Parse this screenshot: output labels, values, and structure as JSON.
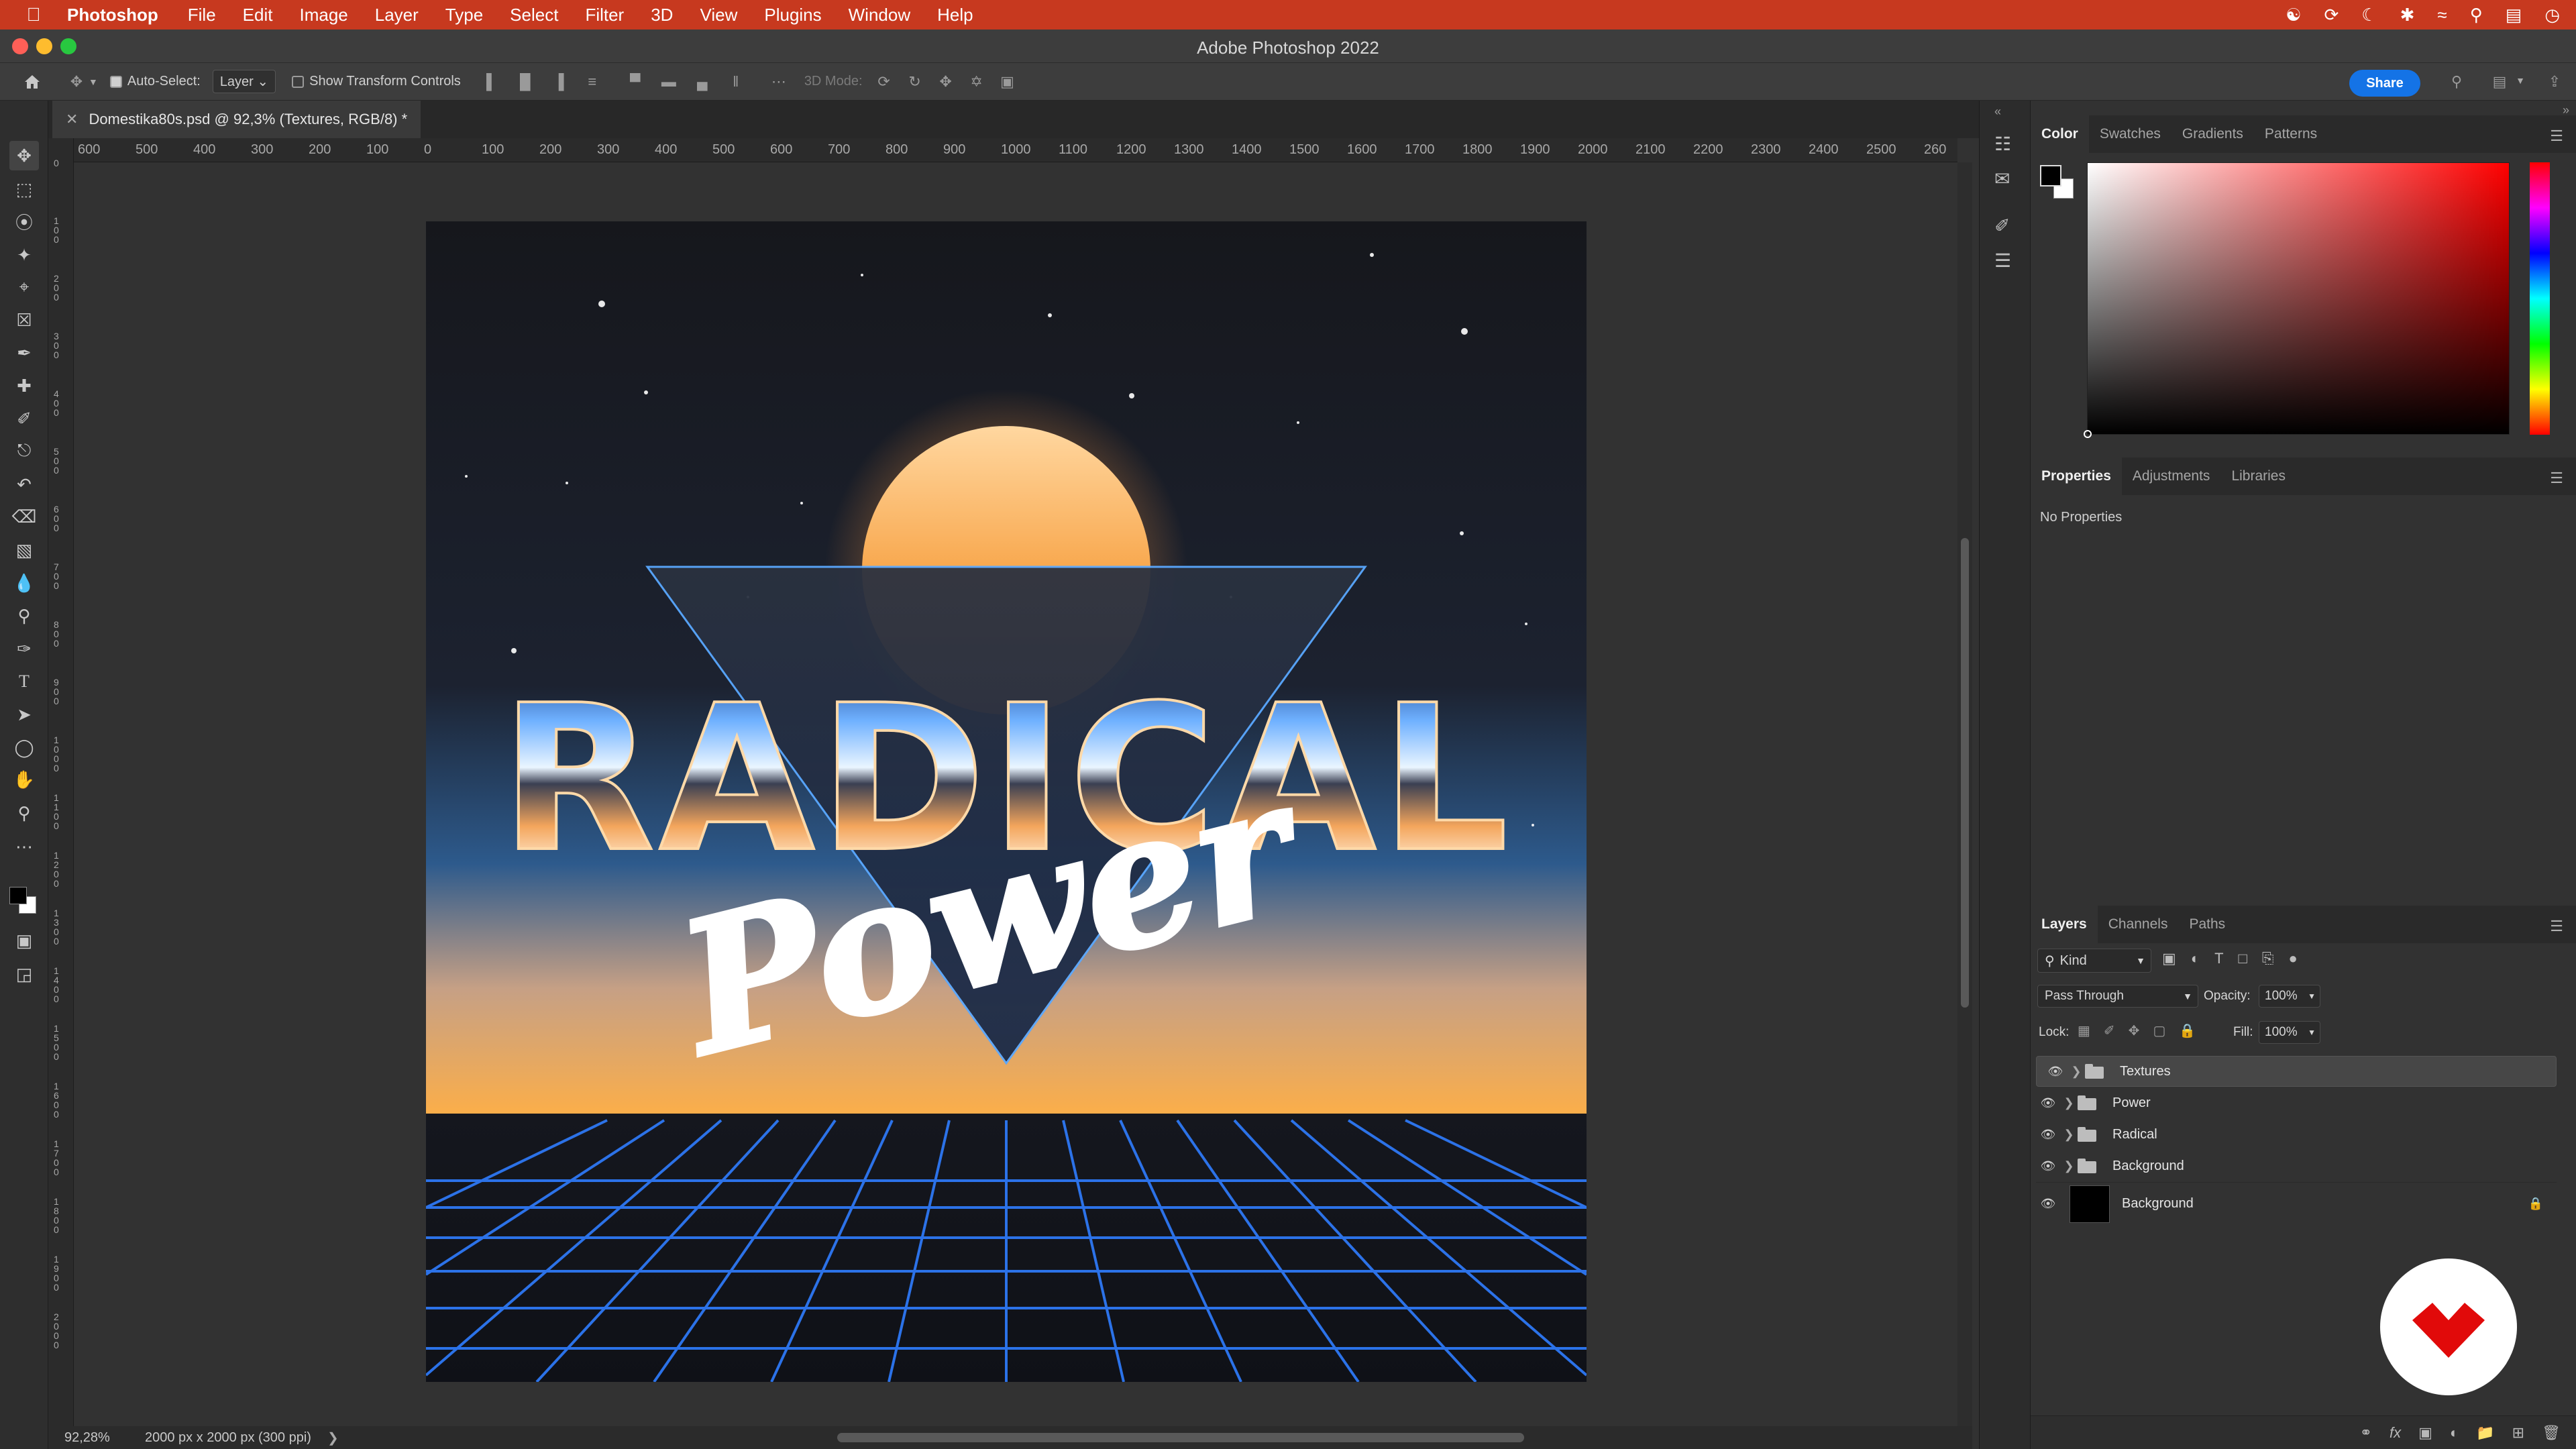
{
  "menubar": {
    "app_name": "Photoshop",
    "items": [
      "File",
      "Edit",
      "Image",
      "Layer",
      "Type",
      "Select",
      "Filter",
      "3D",
      "View",
      "Plugins",
      "Window",
      "Help"
    ],
    "bg_color": "#c7391f"
  },
  "window": {
    "title": "Adobe Photoshop 2022"
  },
  "options_bar": {
    "auto_select_label": "Auto-Select:",
    "auto_select_checked": true,
    "auto_select_target": "Layer",
    "show_transform_label": "Show Transform Controls",
    "show_transform_checked": false,
    "mode_3d_label": "3D Mode:",
    "share_label": "Share"
  },
  "document": {
    "tab_title": "Domestika80s.psd @ 92,3% (Textures, RGB/8) *",
    "zoom": "92,28%",
    "doc_info": "2000 px x 2000 px (300 ppi)"
  },
  "ruler": {
    "h_labels": [
      "600",
      "500",
      "400",
      "300",
      "200",
      "100",
      "0",
      "100",
      "200",
      "300",
      "400",
      "500",
      "600",
      "700",
      "800",
      "900",
      "1000",
      "1100",
      "1200",
      "1300",
      "1400",
      "1500",
      "1600",
      "1700",
      "1800",
      "1900",
      "2000",
      "2100",
      "2200",
      "2300",
      "2400",
      "2500",
      "260"
    ],
    "v_labels": [
      "0",
      "1 0 0",
      "2 0 0",
      "3 0 0",
      "4 0 0",
      "5 0 0",
      "6 0 0",
      "7 0 0",
      "8 0 0",
      "9 0 0",
      "1 0 0 0",
      "1 1 0 0",
      "1 2 0 0",
      "1 3 0 0",
      "1 4 0 0",
      "1 5 0 0",
      "1 6 0 0",
      "1 7 0 0",
      "1 8 0 0",
      "1 9 0 0",
      "2 0 0 0"
    ]
  },
  "artwork": {
    "title_text": "RADICAL",
    "script_text": "Power"
  },
  "color_panel": {
    "tabs": [
      "Color",
      "Swatches",
      "Gradients",
      "Patterns"
    ],
    "active_tab": "Color",
    "foreground": "#000000",
    "background": "#ffffff",
    "hue_color": "#ff0000"
  },
  "properties_panel": {
    "tabs": [
      "Properties",
      "Adjustments",
      "Libraries"
    ],
    "active_tab": "Properties",
    "content": "No Properties"
  },
  "layers_panel": {
    "tabs": [
      "Layers",
      "Channels",
      "Paths"
    ],
    "active_tab": "Layers",
    "filter_kind": "Kind",
    "blend_mode": "Pass Through",
    "opacity_label": "Opacity:",
    "opacity_value": "100%",
    "lock_label": "Lock:",
    "fill_label": "Fill:",
    "fill_value": "100%",
    "layers": [
      {
        "name": "Textures",
        "type": "group",
        "selected": true
      },
      {
        "name": "Power",
        "type": "group",
        "selected": false
      },
      {
        "name": "Radical",
        "type": "group",
        "selected": false
      },
      {
        "name": "Background",
        "type": "group",
        "selected": false
      },
      {
        "name": "Background",
        "type": "layer",
        "locked": true,
        "selected": false
      }
    ]
  },
  "icons": {
    "toolbar": [
      "move-icon",
      "marquee-icon",
      "lasso-icon",
      "magic-wand-icon",
      "crop-icon",
      "frame-icon",
      "eyedropper-icon",
      "healing-icon",
      "brush-icon",
      "stamp-icon",
      "history-brush-icon",
      "eraser-icon",
      "gradient-icon",
      "blur-icon",
      "dodge-icon",
      "pen-icon",
      "type-icon",
      "path-select-icon",
      "ellipse-icon",
      "hand-icon",
      "zoom-icon",
      "more-icon"
    ]
  }
}
